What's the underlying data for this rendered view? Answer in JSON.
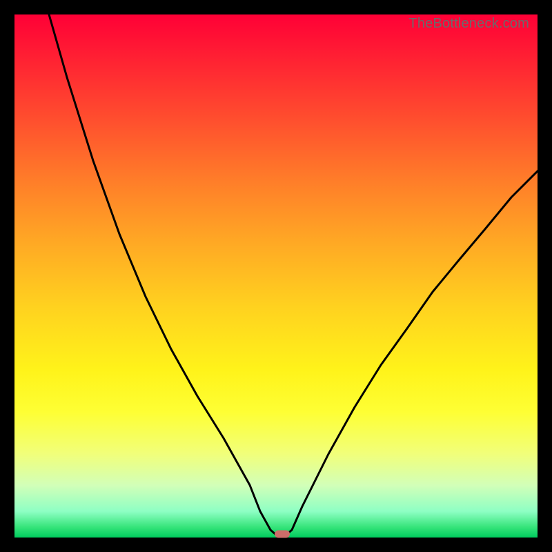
{
  "watermark": "TheBottleneck.com",
  "colors": {
    "background": "#000000",
    "curve": "#000000",
    "marker": "#cc6d6a",
    "gradient_top": "#ff0036",
    "gradient_bottom": "#00cc5e"
  },
  "chart_data": {
    "type": "line",
    "title": "",
    "xlabel": "",
    "ylabel": "",
    "xlim": [
      0,
      100
    ],
    "ylim": [
      0,
      100
    ],
    "grid": false,
    "series": [
      {
        "name": "bottleneck-curve",
        "x": [
          6.6,
          10,
          15,
          20,
          25,
          30,
          35,
          40,
          45,
          47,
          49,
          50,
          51,
          52,
          53,
          55,
          60,
          65,
          70,
          75,
          80,
          85,
          90,
          95,
          100
        ],
        "values": [
          100,
          88,
          72,
          58,
          46,
          36,
          27,
          19,
          10,
          5,
          1.5,
          0.5,
          0.5,
          0.5,
          1.5,
          6,
          16,
          25,
          33,
          40,
          47,
          53,
          59,
          65,
          70
        ]
      }
    ],
    "annotations": [
      {
        "name": "marker",
        "x": 51,
        "y": 0.5
      }
    ]
  }
}
